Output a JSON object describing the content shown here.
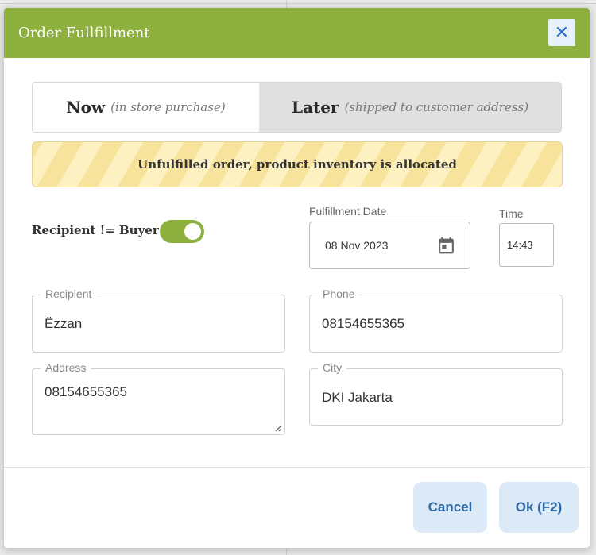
{
  "dialog": {
    "title": "Order Fullfillment",
    "close_label": "✕"
  },
  "tabs": [
    {
      "label": "Now",
      "sublabel": "(in store purchase)"
    },
    {
      "label": "Later",
      "sublabel": "(shipped to customer address)"
    }
  ],
  "alert": {
    "text": "Unfulfilled order, product inventory is allocated"
  },
  "toggle": {
    "label": "Recipient != Buyer",
    "checked": true
  },
  "fulfillment_date": {
    "label": "Fulfillment Date",
    "value": "08 Nov 2023",
    "icon": "calendar-icon"
  },
  "time": {
    "label": "Time",
    "value": "14:43"
  },
  "recipient": {
    "label": "Recipient",
    "value": "Ëzzan"
  },
  "phone": {
    "label": "Phone",
    "value": "08154655365"
  },
  "address": {
    "label": "Address",
    "value": "08154655365"
  },
  "city": {
    "label": "City",
    "value": "DKI Jakarta"
  },
  "buttons": {
    "cancel": "Cancel",
    "ok": "Ok (F2)"
  },
  "colors": {
    "header": "#8db03f",
    "toggle": "#8db03f",
    "button_bg": "#dceaf8",
    "button_text": "#2f6aa6"
  }
}
